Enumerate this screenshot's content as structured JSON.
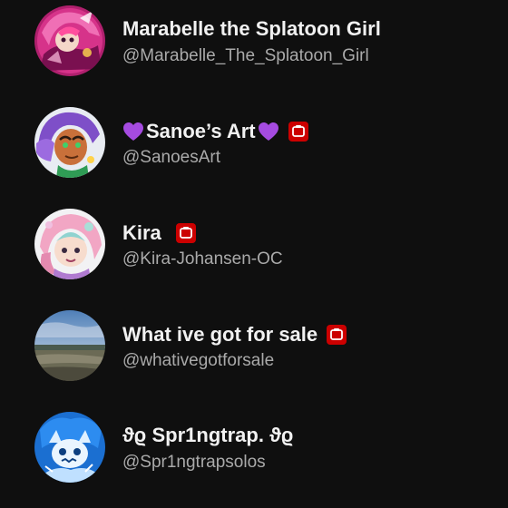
{
  "channels": [
    {
      "name": "Marabelle the Splatoon Girl",
      "handle": "@Marabelle_The_Splatoon_Girl",
      "avatar_icon": "pink-splatoon-girl-avatar",
      "badge": false
    },
    {
      "name": "Sanoe’s Art",
      "name_prefix_icon": "purple-heart-emoji",
      "name_suffix_icon": "purple-heart-emoji",
      "handle": "@SanoesArt",
      "avatar_icon": "purple-hair-octoling-avatar",
      "badge": true
    },
    {
      "name": "Kira",
      "handle": "@Kira-Johansen-OC",
      "avatar_icon": "pink-hair-oc-avatar",
      "badge": true
    },
    {
      "name": "What ive got for sale",
      "handle": "@whativegotforsale",
      "avatar_icon": "beach-landscape-avatar",
      "badge": true
    },
    {
      "name": "ϑϱ Spr1ngtrap. ϑϱ",
      "handle": "@Spr1ngtrapsolos",
      "avatar_icon": "blue-sketch-avatar",
      "badge": false
    }
  ],
  "colors": {
    "background": "#0f0f0f",
    "name_text": "#f1f1f1",
    "handle_text": "#aaaaaa",
    "badge_red": "#cc0000",
    "heart_purple": "#a54be0"
  }
}
